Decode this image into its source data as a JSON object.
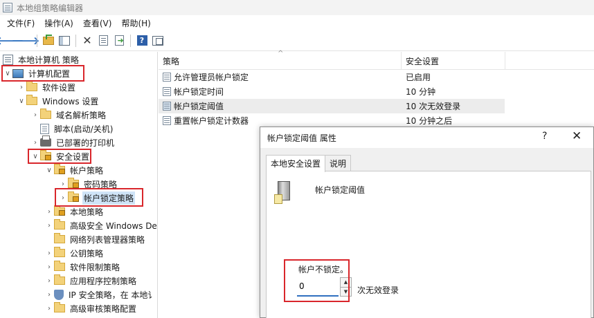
{
  "window": {
    "title": "本地组策略编辑器"
  },
  "menu": [
    "文件(F)",
    "操作(A)",
    "查看(V)",
    "帮助(H)"
  ],
  "toolbar": {
    "icons": [
      "back-arrow-icon",
      "forward-arrow-icon",
      "up-folder-icon",
      "show-hide-tree-icon",
      "delete-icon",
      "properties-icon",
      "export-list-icon",
      "help-icon",
      "action-pane-icon"
    ]
  },
  "tree": {
    "items": [
      {
        "label": "本地计算机 策略",
        "icon": "policy-root-icon"
      },
      {
        "label": "计算机配置",
        "icon": "computer-icon",
        "expanded": true,
        "highlighted": true
      },
      {
        "label": "软件设置",
        "icon": "folder-icon"
      },
      {
        "label": "Windows 设置",
        "icon": "folder-icon",
        "expanded": true
      },
      {
        "label": "域名解析策略",
        "icon": "folder-icon"
      },
      {
        "label": "脚本(启动/关机)",
        "icon": "script-icon"
      },
      {
        "label": "已部署的打印机",
        "icon": "printer-icon"
      },
      {
        "label": "安全设置",
        "icon": "security-icon",
        "expanded": true,
        "highlighted": true
      },
      {
        "label": "帐户策略",
        "icon": "locked-folder-icon",
        "expanded": true
      },
      {
        "label": "密码策略",
        "icon": "locked-folder-icon"
      },
      {
        "label": "帐户锁定策略",
        "icon": "locked-folder-icon",
        "selected": true,
        "highlighted": true
      },
      {
        "label": "本地策略",
        "icon": "locked-folder-icon"
      },
      {
        "label": "高级安全 Windows De",
        "icon": "folder-icon"
      },
      {
        "label": "网络列表管理器策略",
        "icon": "folder-icon"
      },
      {
        "label": "公钥策略",
        "icon": "folder-icon"
      },
      {
        "label": "软件限制策略",
        "icon": "folder-icon"
      },
      {
        "label": "应用程序控制策略",
        "icon": "folder-icon"
      },
      {
        "label": "IP 安全策略，在 本地讠",
        "icon": "shield-icon"
      },
      {
        "label": "高级审核策略配置",
        "icon": "folder-icon"
      }
    ]
  },
  "list": {
    "columns": [
      "策略",
      "安全设置"
    ],
    "rows": [
      {
        "name": "允许管理员帐户锁定",
        "value": "已启用"
      },
      {
        "name": "帐户锁定时间",
        "value": "10 分钟"
      },
      {
        "name": "帐户锁定阈值",
        "value": "10 次无效登录",
        "selected": true
      },
      {
        "name": "重置帐户锁定计数器",
        "value": "10 分钟之后"
      }
    ]
  },
  "dialog": {
    "title": "帐户锁定阈值 属性",
    "help": "?",
    "close": "✕",
    "tabs": [
      "本地安全设置",
      "说明"
    ],
    "setting_name": "帐户锁定阈值",
    "lockout_label": "帐户不锁定。",
    "input_value": "0",
    "unit_label": "次无效登录",
    "spin_up": "▲",
    "spin_down": "▼"
  }
}
